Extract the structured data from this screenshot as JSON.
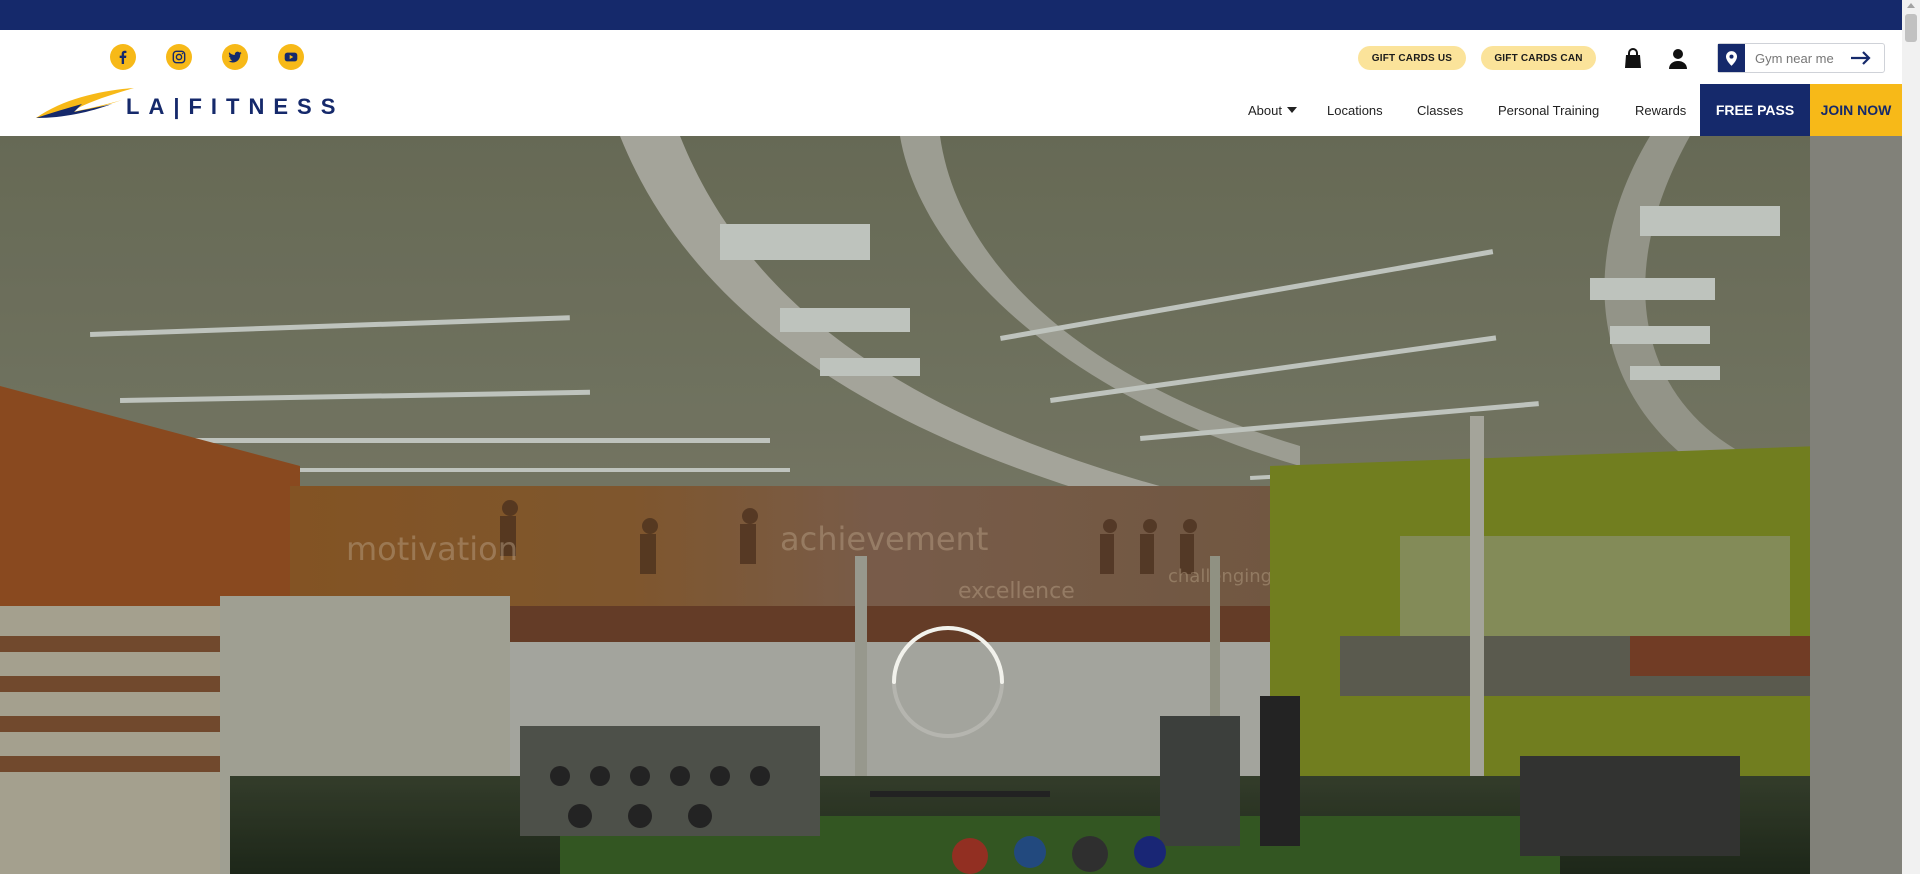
{
  "brand": {
    "name": "LA|FITNESS",
    "colors": {
      "navy": "#15296b",
      "gold": "#f7b918",
      "gift_pill": "#fbe39a"
    }
  },
  "social": [
    {
      "name": "facebook-icon"
    },
    {
      "name": "instagram-icon"
    },
    {
      "name": "twitter-icon"
    },
    {
      "name": "youtube-icon"
    }
  ],
  "header": {
    "gift_cards_us": "GIFT CARDS US",
    "gift_cards_can": "GIFT CARDS CAN",
    "cart_icon": "shopping-bag-icon",
    "account_icon": "user-icon",
    "search": {
      "placeholder": "Gym near me",
      "value": ""
    }
  },
  "nav": {
    "about": "About",
    "locations": "Locations",
    "classes": "Classes",
    "personal_training": "Personal Training",
    "rewards": "Rewards",
    "free_pass": "FREE PASS",
    "join_now": "JOIN NOW"
  },
  "hero": {
    "wall_words": [
      "motivation",
      "achievement",
      "excellence",
      "challenging"
    ],
    "loading": "loading-spinner-icon"
  }
}
